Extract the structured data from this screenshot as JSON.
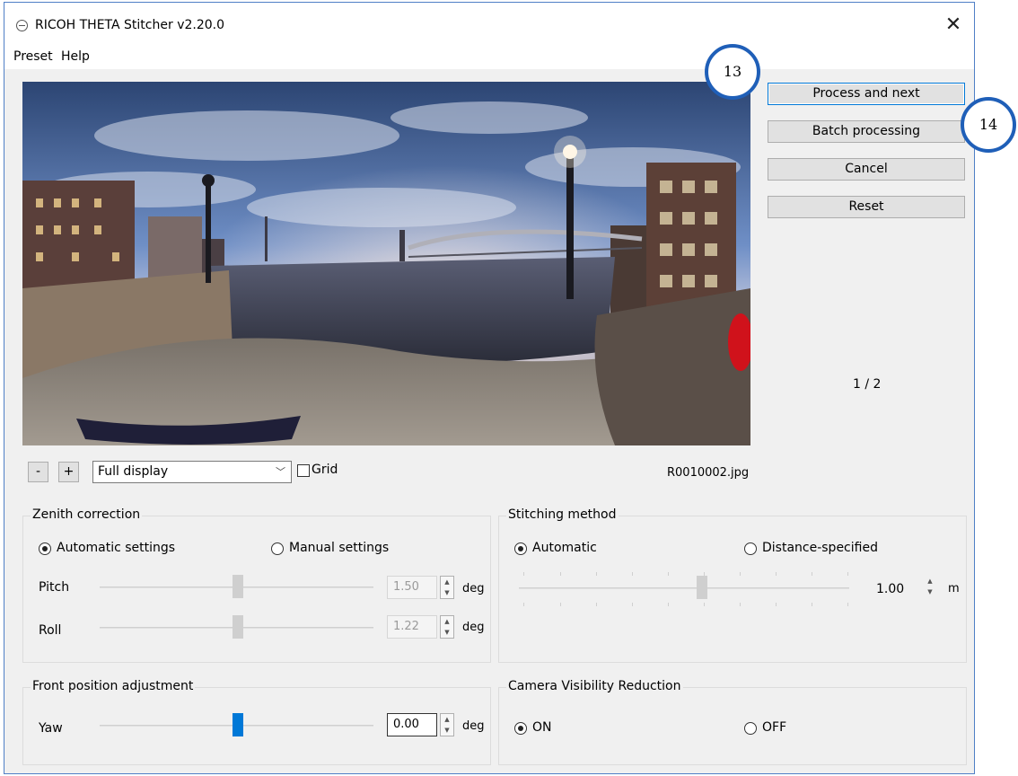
{
  "window": {
    "title": "RICOH THETA Stitcher v2.20.0",
    "close_glyph": "✕"
  },
  "menu": [
    "Preset",
    "Help"
  ],
  "actions": {
    "process_next": "Process and next",
    "batch": "Batch processing",
    "cancel": "Cancel",
    "reset": "Reset"
  },
  "callouts": [
    "13",
    "14"
  ],
  "page_indicator": "1 / 2",
  "toolbar": {
    "zoom_out": "-",
    "zoom_in": "+",
    "display_mode": "Full display",
    "grid_label": "Grid",
    "grid_checked": false,
    "filename": "R0010002.jpg"
  },
  "zenith": {
    "title": "Zenith correction",
    "auto_label": "Automatic settings",
    "manual_label": "Manual settings",
    "pitch_label": "Pitch",
    "pitch_value": "1.50",
    "roll_label": "Roll",
    "roll_value": "1.22",
    "unit": "deg"
  },
  "stitching": {
    "title": "Stitching method",
    "auto_label": "Automatic",
    "distance_label": "Distance-specified",
    "distance_value": "1.00",
    "unit": "m"
  },
  "front": {
    "title": "Front position adjustment",
    "yaw_label": "Yaw",
    "yaw_value": "0.00",
    "unit": "deg"
  },
  "camera": {
    "title": "Camera Visibility Reduction",
    "on_label": "ON",
    "off_label": "OFF"
  },
  "colors": {
    "accent": "#0078d7",
    "callout_border": "#1f5fb8"
  }
}
